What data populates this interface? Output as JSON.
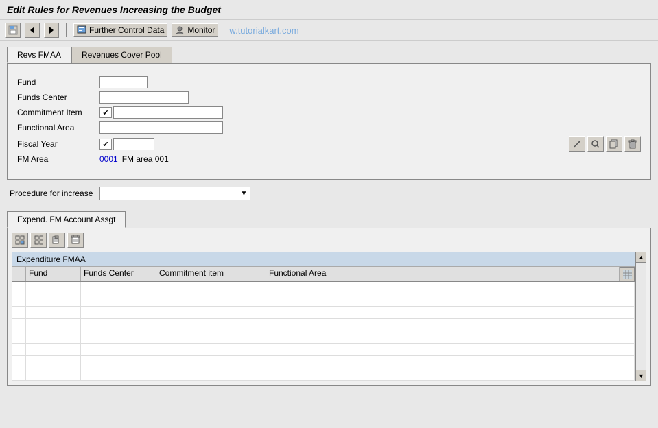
{
  "title": "Edit Rules for Revenues Increasing the Budget",
  "toolbar": {
    "icons": [
      "save-icon",
      "back-icon",
      "forward-icon"
    ],
    "further_control_data": "Further Control Data",
    "monitor": "Monitor",
    "watermark": "w.tutorialkart.com"
  },
  "tabs": [
    {
      "label": "Revs FMAA",
      "active": true
    },
    {
      "label": "Revenues Cover Pool",
      "active": false
    }
  ],
  "form": {
    "fund_label": "Fund",
    "funds_center_label": "Funds Center",
    "commitment_item_label": "Commitment Item",
    "functional_area_label": "Functional Area",
    "fiscal_year_label": "Fiscal Year",
    "fm_area_label": "FM Area",
    "fm_area_code": "0001",
    "fm_area_value": "FM area 001",
    "fund_value": "",
    "funds_center_value": "",
    "commitment_item_checked": true,
    "functional_area_value": "",
    "fiscal_year_checked": true
  },
  "procedure": {
    "label": "Procedure for increase",
    "value": ""
  },
  "sub_tabs": [
    {
      "label": "Expend. FM Account Assgt",
      "active": true
    }
  ],
  "table": {
    "title": "Expenditure FMAA",
    "columns": [
      "Fund",
      "Funds Center",
      "Commitment item",
      "Functional Area"
    ],
    "rows": [
      {
        "fund": "",
        "funds_center": "",
        "commitment_item": "",
        "functional_area": ""
      },
      {
        "fund": "",
        "funds_center": "",
        "commitment_item": "",
        "functional_area": ""
      },
      {
        "fund": "",
        "funds_center": "",
        "commitment_item": "",
        "functional_area": ""
      },
      {
        "fund": "",
        "funds_center": "",
        "commitment_item": "",
        "functional_area": ""
      },
      {
        "fund": "",
        "funds_center": "",
        "commitment_item": "",
        "functional_area": ""
      },
      {
        "fund": "",
        "funds_center": "",
        "commitment_item": "",
        "functional_area": ""
      },
      {
        "fund": "",
        "funds_center": "",
        "commitment_item": "",
        "functional_area": ""
      },
      {
        "fund": "",
        "funds_center": "",
        "commitment_item": "",
        "functional_area": ""
      }
    ]
  },
  "icons": {
    "save": "💾",
    "back": "◀",
    "forward": "▶",
    "further_ctrl_icon": "🖥",
    "monitor_icon": "👤",
    "pencil": "✏",
    "match": "🔍",
    "copy": "📋",
    "delete": "🗑",
    "table_icon": "⊞",
    "scroll_up": "▲",
    "scroll_down": "▼",
    "add_row": "⊞",
    "check": "✔"
  }
}
